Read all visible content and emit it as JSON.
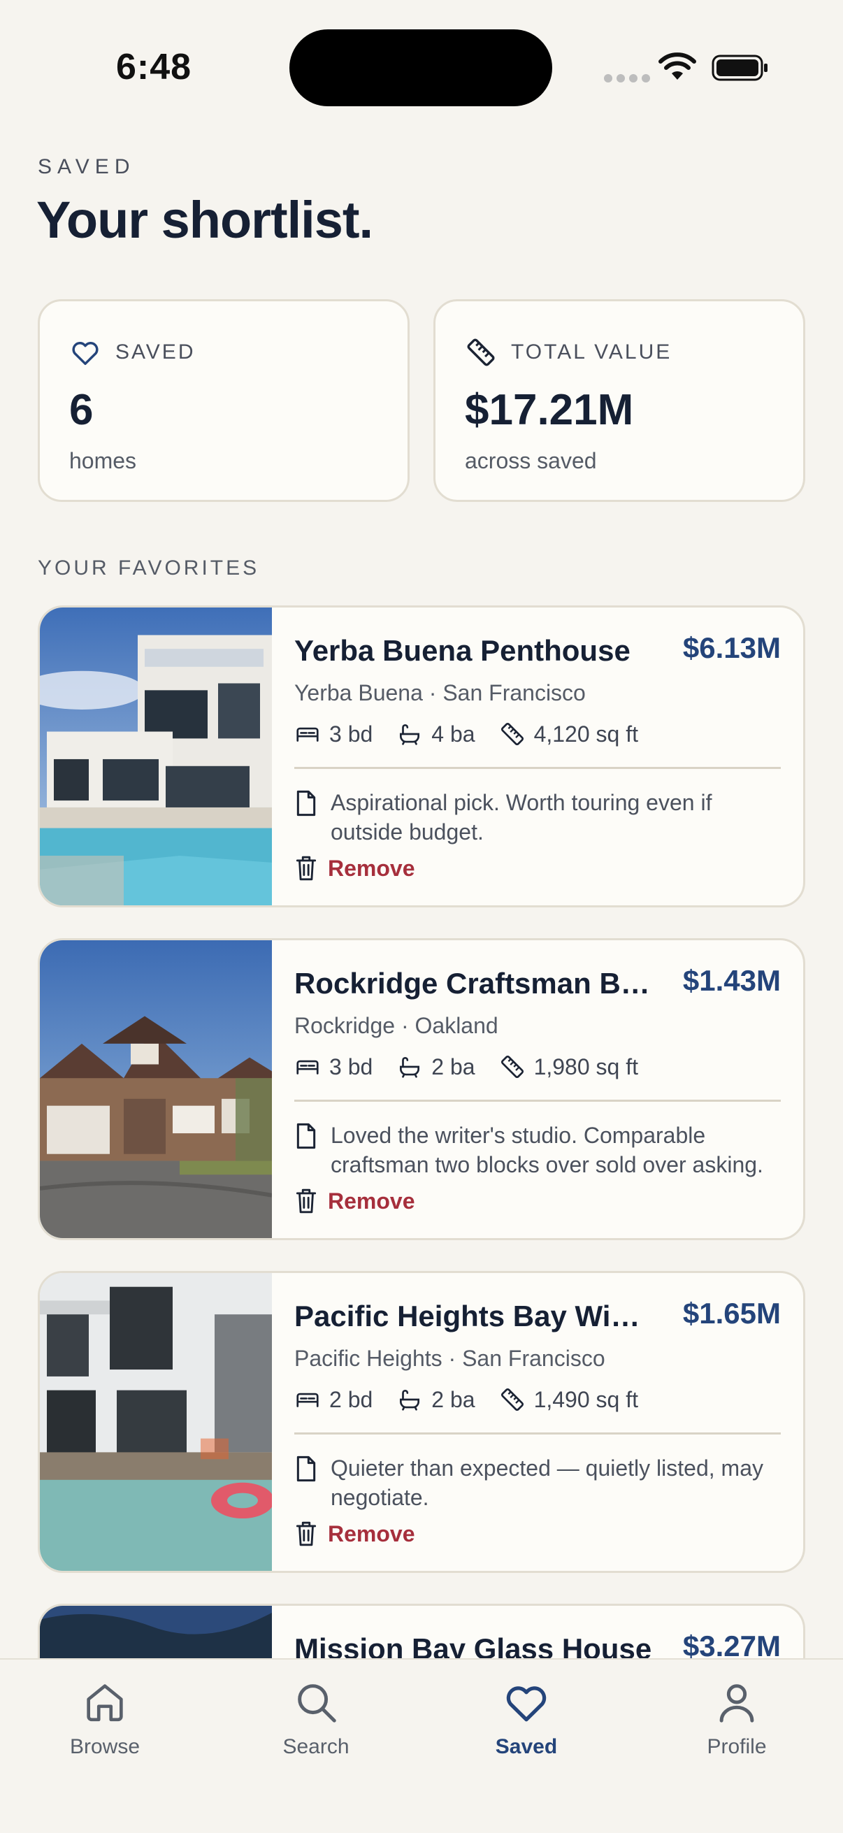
{
  "status_bar": {
    "time": "6:48"
  },
  "header": {
    "eyebrow": "SAVED",
    "title": "Your shortlist."
  },
  "stats": [
    {
      "icon": "heart-icon",
      "label": "SAVED",
      "value": "6",
      "sub": "homes"
    },
    {
      "icon": "ruler-icon",
      "label": "TOTAL VALUE",
      "value": "$17.21M",
      "sub": "across saved"
    }
  ],
  "section_label": "YOUR FAVORITES",
  "listings": [
    {
      "name": "Yerba Buena Penthouse",
      "price": "$6.13M",
      "location": "Yerba Buena · San Francisco",
      "beds": "3 bd",
      "baths": "4 ba",
      "sqft": "4,120 sq ft",
      "note": "Aspirational pick. Worth touring even if outside budget.",
      "remove": "Remove"
    },
    {
      "name": "Rockridge Craftsman Bungalow",
      "price": "$1.43M",
      "location": "Rockridge · Oakland",
      "beds": "3 bd",
      "baths": "2 ba",
      "sqft": "1,980 sq ft",
      "note": "Loved the writer's studio. Comparable craftsman two blocks over sold over asking.",
      "remove": "Remove"
    },
    {
      "name": "Pacific Heights Bay Window",
      "price": "$1.65M",
      "location": "Pacific Heights · San Francisco",
      "beds": "2 bd",
      "baths": "2 ba",
      "sqft": "1,490 sq ft",
      "note": "Quieter than expected — quietly listed, may negotiate.",
      "remove": "Remove"
    },
    {
      "name": "Mission Bay Glass House",
      "price": "$3.27M"
    }
  ],
  "tabs": [
    {
      "label": "Browse",
      "icon": "home-icon",
      "active": false
    },
    {
      "label": "Search",
      "icon": "search-icon",
      "active": false
    },
    {
      "label": "Saved",
      "icon": "heart-icon",
      "active": true
    },
    {
      "label": "Profile",
      "icon": "person-icon",
      "active": false
    }
  ],
  "colors": {
    "accent": "#24447a",
    "remove": "#a62f3c",
    "background": "#f6f4ef",
    "card": "#fdfcf8"
  }
}
